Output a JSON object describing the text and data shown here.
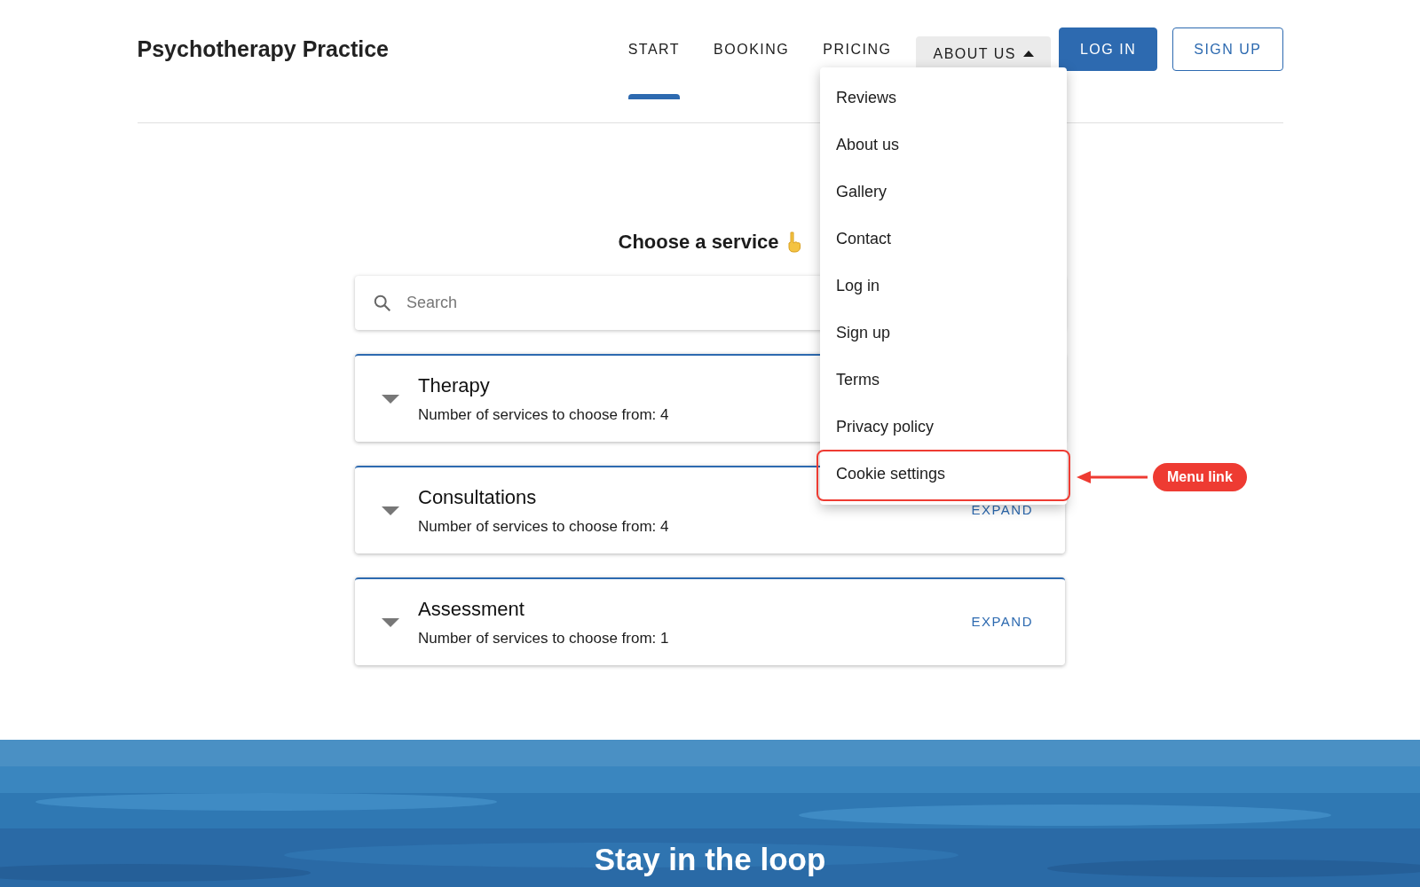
{
  "header": {
    "logo": "Psychotherapy Practice",
    "nav": [
      {
        "label": "START",
        "selected": true,
        "kind": "link"
      },
      {
        "label": "BOOKING",
        "selected": false,
        "kind": "link"
      },
      {
        "label": "PRICING",
        "selected": false,
        "kind": "link"
      },
      {
        "label": "ABOUT US",
        "selected": false,
        "kind": "dropdown",
        "expanded": true
      }
    ],
    "buttons": [
      {
        "label": "LOG IN",
        "kind": "filled"
      },
      {
        "label": "SIGN UP",
        "kind": "outlined"
      }
    ]
  },
  "menu": {
    "items": [
      {
        "label": "Reviews",
        "highlighted": false
      },
      {
        "label": "About us",
        "highlighted": false
      },
      {
        "label": "Gallery",
        "highlighted": false
      },
      {
        "label": "Contact",
        "highlighted": false
      },
      {
        "label": "Log in",
        "highlighted": false
      },
      {
        "label": "Sign up",
        "highlighted": false
      },
      {
        "label": "Terms",
        "highlighted": false
      },
      {
        "label": "Privacy policy",
        "highlighted": false
      },
      {
        "label": "Cookie settings",
        "highlighted": true
      }
    ]
  },
  "annotation": {
    "label": "Menu link"
  },
  "heading": "Choose a service",
  "search": {
    "placeholder": "Search"
  },
  "categories": [
    {
      "title": "Therapy",
      "subtitle": "Number of services to choose from: 4"
    },
    {
      "title": "Consultations",
      "subtitle": "Number of services to choose from: 4",
      "action": "EXPAND"
    },
    {
      "title": "Assessment",
      "subtitle": "Number of services to choose from: 1",
      "action": "EXPAND"
    }
  ],
  "banner": {
    "kind": "picture",
    "title": "Stay in the loop"
  }
}
